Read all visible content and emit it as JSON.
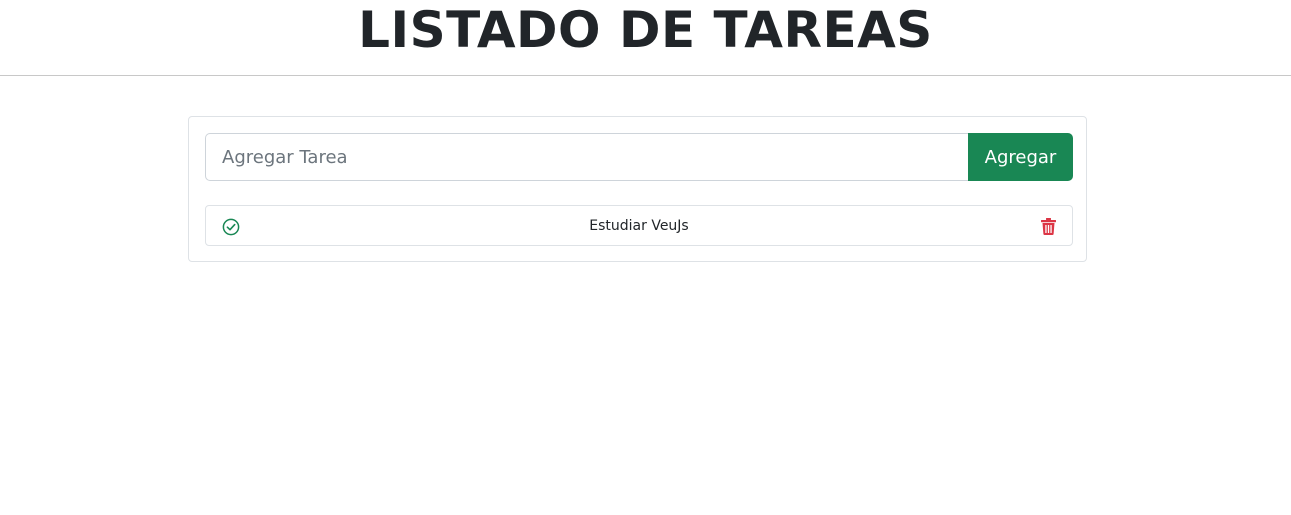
{
  "header": {
    "title": "LISTADO DE TAREAS"
  },
  "form": {
    "input_value": "",
    "input_placeholder": "Agregar Tarea",
    "add_button_label": "Agregar"
  },
  "tasks": [
    {
      "text": "Estudiar VeuJs",
      "status_icon": "check-circle-icon",
      "delete_icon": "trash-icon"
    }
  ],
  "colors": {
    "accent": "#198754",
    "check_icon": "#198754",
    "danger": "#dc3545",
    "border": "#dee2e6"
  }
}
